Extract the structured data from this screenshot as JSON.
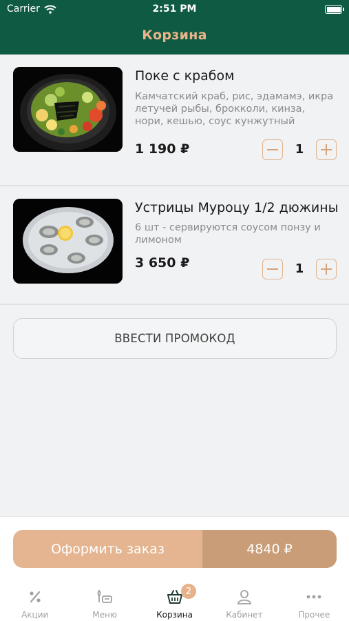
{
  "status_bar": {
    "carrier": "Carrier",
    "time": "2:51 PM"
  },
  "header": {
    "title": "Корзина"
  },
  "cart": {
    "items": [
      {
        "name": "Поке с крабом",
        "description": "Камчатский краб, рис, эдамамэ, икра летучей рыбы, брокколи, кинза, нори, кешью, соус кунжутный",
        "price": "1 190 ₽",
        "quantity": "1"
      },
      {
        "name": "Устрицы Муроцу 1/2 дюжины",
        "description": "6 шт - сервируются соусом понзу и лимоном",
        "price": "3 650 ₽",
        "quantity": "1"
      }
    ]
  },
  "promo": {
    "label": "ВВЕСТИ ПРОМОКОД"
  },
  "checkout": {
    "label": "Оформить заказ",
    "total": "4840 ₽"
  },
  "tabbar": {
    "items": [
      {
        "label": "Акции",
        "icon": "percent-icon"
      },
      {
        "label": "Меню",
        "icon": "menu-icon"
      },
      {
        "label": "Корзина",
        "icon": "basket-icon",
        "badge": "2"
      },
      {
        "label": "Кабинет",
        "icon": "user-icon"
      },
      {
        "label": "Прочее",
        "icon": "more-icon"
      }
    ]
  },
  "colors": {
    "header": "#0e5a43",
    "accent": "#e4b590",
    "accent_dark": "#c99d78",
    "title": "#e9b489"
  }
}
